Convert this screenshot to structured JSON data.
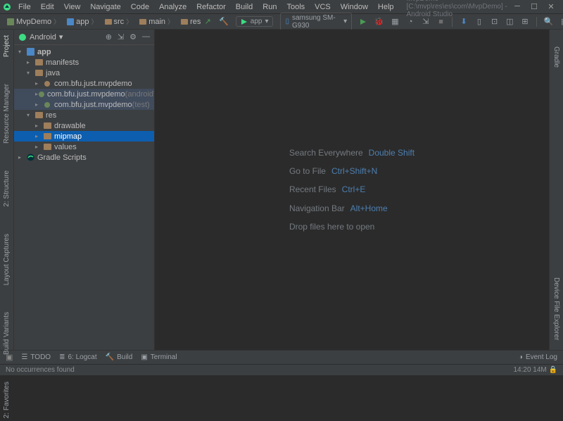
{
  "window": {
    "title": "MvpDemo [C:\\mvp\\res\\es\\com\\MvpDemo] - Android Studio"
  },
  "menu": [
    "File",
    "Edit",
    "View",
    "Navigate",
    "Code",
    "Analyze",
    "Refactor",
    "Build",
    "Run",
    "Tools",
    "VCS",
    "Window",
    "Help"
  ],
  "breadcrumbs": [
    {
      "label": "MvpDemo",
      "icon": "project"
    },
    {
      "label": "app",
      "icon": "module"
    },
    {
      "label": "src",
      "icon": "folder"
    },
    {
      "label": "main",
      "icon": "folder"
    },
    {
      "label": "res",
      "icon": "folder"
    }
  ],
  "runbar": {
    "config": "app",
    "device": "samsung SM-G930",
    "device_arrow": "▾"
  },
  "project_panel": {
    "mode": "Android",
    "mode_arrow": "▾"
  },
  "tree": [
    {
      "indent": 0,
      "arrow": "▾",
      "icon": "module",
      "label": "app",
      "kind": "module"
    },
    {
      "indent": 1,
      "arrow": "▸",
      "icon": "folder",
      "label": "manifests"
    },
    {
      "indent": 1,
      "arrow": "▾",
      "icon": "folder",
      "label": "java"
    },
    {
      "indent": 2,
      "arrow": "▸",
      "icon": "package",
      "label": "com.bfu.just.mvpdemo"
    },
    {
      "indent": 2,
      "arrow": "▸",
      "icon": "package",
      "label": "com.bfu.just.mvpdemo",
      "suffix": "(androidTest)",
      "hl": "inactive"
    },
    {
      "indent": 2,
      "arrow": "▸",
      "icon": "package",
      "label": "com.bfu.just.mvpdemo",
      "suffix": "(test)",
      "hl": "inactive"
    },
    {
      "indent": 1,
      "arrow": "▾",
      "icon": "folder",
      "label": "res"
    },
    {
      "indent": 2,
      "arrow": "▸",
      "icon": "folder",
      "label": "drawable"
    },
    {
      "indent": 2,
      "arrow": "▸",
      "icon": "folder",
      "label": "mipmap",
      "hl": "selected"
    },
    {
      "indent": 2,
      "arrow": "▸",
      "icon": "folder",
      "label": "values"
    },
    {
      "indent": 0,
      "arrow": "▸",
      "icon": "gradle",
      "label": "Gradle Scripts"
    }
  ],
  "hints": [
    {
      "text": "Search Everywhere",
      "shortcut": "Double Shift"
    },
    {
      "text": "Go to File",
      "shortcut": "Ctrl+Shift+N"
    },
    {
      "text": "Recent Files",
      "shortcut": "Ctrl+E"
    },
    {
      "text": "Navigation Bar",
      "shortcut": "Alt+Home"
    },
    {
      "text": "Drop files here to open",
      "shortcut": ""
    }
  ],
  "left_tabs": [
    "Project",
    "Resource Manager",
    "2: Structure",
    "Layout Captures",
    "Build Variants",
    "2: Favorites"
  ],
  "right_tabs": [
    "Gradle",
    "Device File Explorer"
  ],
  "bottom_tabs": [
    {
      "icon": "☰",
      "label": "TODO"
    },
    {
      "icon": "≣",
      "label": "6: Logcat"
    },
    {
      "icon": "🔨",
      "label": "Build"
    },
    {
      "icon": "▣",
      "label": "Terminal"
    }
  ],
  "bottom_right": {
    "label": "Event Log",
    "icon": "◑"
  },
  "status": {
    "left": "No occurrences found",
    "right": "14:20  14M"
  }
}
